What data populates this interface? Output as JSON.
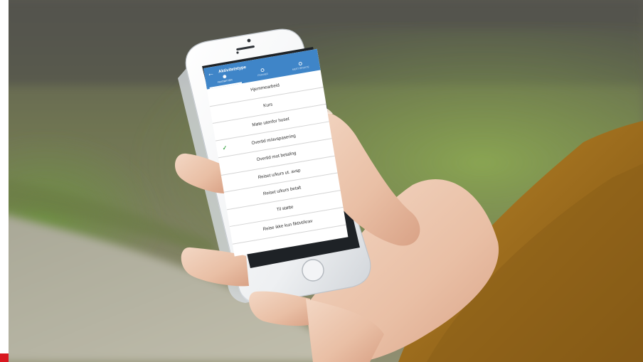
{
  "app": {
    "title": "Aktivitetstype",
    "back_icon": "arrow-left-icon"
  },
  "tabs": [
    {
      "label": "FAVORITTER",
      "active": true
    },
    {
      "label": "FRAVÆR",
      "active": false
    },
    {
      "label": "MEST BRUKTE",
      "active": false
    }
  ],
  "list": [
    {
      "label": "Hjemmearbeid",
      "checked": false
    },
    {
      "label": "Kurs",
      "checked": false
    },
    {
      "label": "Møte utenfor huset",
      "checked": false
    },
    {
      "label": "Overtid m/avspasering",
      "checked": true
    },
    {
      "label": "Overtid mot betaling",
      "checked": false
    },
    {
      "label": "Reiset u/kurs ut. avsp",
      "checked": false
    },
    {
      "label": "Reiset u/kurs betalt",
      "checked": false
    },
    {
      "label": "Til støtte",
      "checked": false
    },
    {
      "label": "Reise ikke kun fiktivt/krav",
      "checked": false
    }
  ],
  "colors": {
    "appbar": "#3f85c8",
    "check": "#3fa64a",
    "corner_mark": "#d8171f"
  }
}
